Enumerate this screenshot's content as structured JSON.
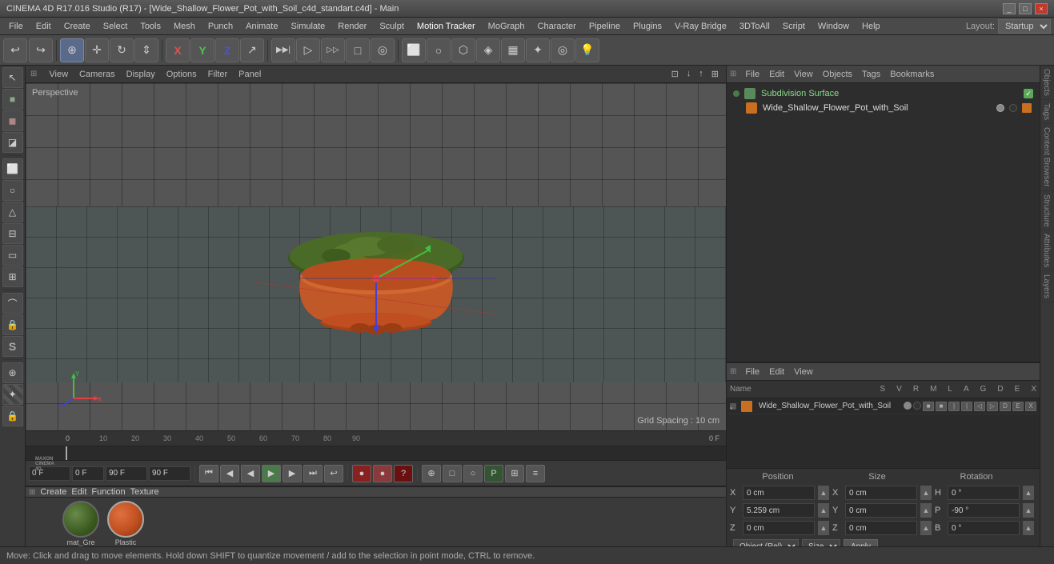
{
  "titlebar": {
    "title": "CINEMA 4D R17.016 Studio (R17) - [Wide_Shallow_Flower_Pot_with_Soil_c4d_standart.c4d] - Main",
    "minimize": "_",
    "maximize": "□",
    "close": "×"
  },
  "menubar": {
    "items": [
      "File",
      "Edit",
      "Create",
      "Select",
      "Tools",
      "Mesh",
      "Punch",
      "Animate",
      "Simulate",
      "Render",
      "Sculpt",
      "Motion Tracker",
      "MoGraph",
      "Character",
      "Pipeline",
      "Plugins",
      "V-Ray Bridge",
      "3DToAll",
      "Script",
      "Window",
      "Help"
    ],
    "layout_label": "Layout:",
    "layout_value": "Startup"
  },
  "toolbar": {
    "undo_label": "↩",
    "mode_buttons": [
      "⊕",
      "↔",
      "○",
      "↕",
      "X",
      "Y",
      "Z",
      "↗"
    ],
    "view_buttons": [
      "▶▶|",
      "▷",
      "▷▷",
      "□",
      "○",
      "✧",
      "◎",
      "⬡",
      "💡"
    ],
    "snap_label": "S",
    "axis_x": "X",
    "axis_y": "Y",
    "axis_z": "Z"
  },
  "viewport": {
    "perspective_label": "Perspective",
    "grid_spacing": "Grid Spacing : 10 cm",
    "toolbar_items": [
      "View",
      "Cameras",
      "Display",
      "Options",
      "Filter",
      "Panel"
    ]
  },
  "object_manager": {
    "toolbar": [
      "File",
      "Edit",
      "View",
      "Objects",
      "Tags",
      "Bookmarks"
    ],
    "items": [
      {
        "name": "Subdivision Surface",
        "type": "modifier",
        "color": "green",
        "active": true
      },
      {
        "name": "Wide_Shallow_Flower_Pot_with_Soil",
        "type": "object",
        "color": "orange"
      }
    ]
  },
  "attribute_manager": {
    "toolbar": [
      "File",
      "Edit",
      "View"
    ],
    "columns": [
      "Name",
      "S",
      "V",
      "R",
      "M",
      "L",
      "A",
      "G",
      "D",
      "E",
      "X"
    ],
    "rows": [
      {
        "name": "Wide_Shallow_Flower_Pot_with_Soil",
        "color": "#c87020"
      }
    ]
  },
  "timeline": {
    "frame_start": "0 F",
    "frame_end": "90 F",
    "current_frame": "0 F",
    "preview_start": "0 F",
    "preview_end": "90 F",
    "ticks": [
      "0",
      "10",
      "20",
      "30",
      "40",
      "50",
      "60",
      "70",
      "80",
      "90"
    ],
    "tick_interval": 10
  },
  "transport": {
    "frame_field": "0 F",
    "frame_start": "0 F",
    "frame_end": "90 F",
    "buttons": [
      "⏮",
      "◀◀",
      "◀",
      "▶",
      "▶▶",
      "⏭",
      "↩"
    ],
    "play_btn": "▶"
  },
  "materials": {
    "toolbar": [
      "Create",
      "Edit",
      "Function",
      "Texture"
    ],
    "items": [
      {
        "name": "mat_Gre",
        "color": "#4a6a3a"
      },
      {
        "name": "Plastic",
        "color": "#c05020"
      }
    ]
  },
  "transform": {
    "position_label": "Position",
    "size_label": "Size",
    "rotation_label": "Rotation",
    "x_pos": "0 cm",
    "y_pos": "5.259 cm",
    "z_pos": "0 cm",
    "x_size": "0 cm",
    "y_size": "0 cm",
    "z_size": "0 cm",
    "x_rot": "0 °",
    "y_rot": "-90 °",
    "z_rot": "0 °",
    "coord_system": "Object (Rel)",
    "size_mode": "Size",
    "apply_btn": "Apply"
  },
  "statusbar": {
    "text": "Move: Click and drag to move elements. Hold down SHIFT to quantize movement / add to the selection in point mode, CTRL to remove."
  },
  "playback_controls": {
    "red_btns": [
      "●",
      "●",
      "?"
    ],
    "arrow_btns": [
      "⏮",
      "◀",
      "▶",
      "▶▶",
      "⏭",
      "↩"
    ],
    "extra_btns": [
      "⊕",
      "□",
      "○",
      "P",
      "⊞",
      "≡"
    ]
  },
  "right_vtabs": [
    "Objects",
    "Tags",
    "Content Browser",
    "Structure",
    "Attributes",
    "Layers"
  ]
}
